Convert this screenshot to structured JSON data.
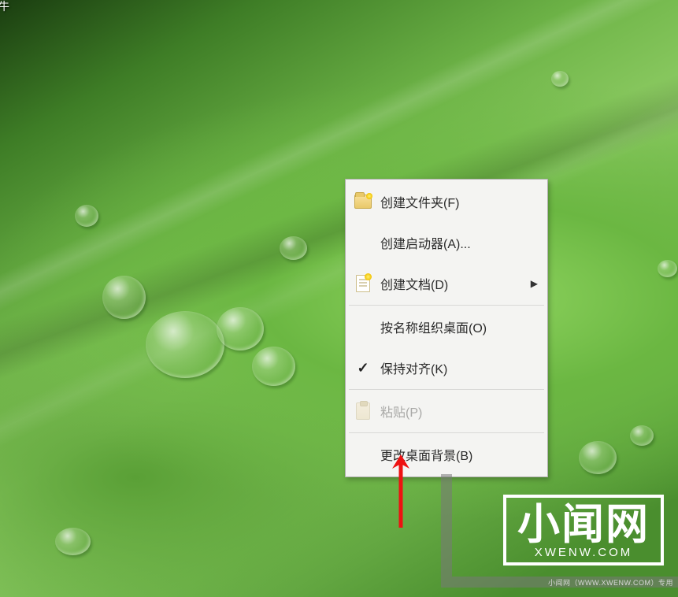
{
  "desktop": {
    "partial_icon_label": "牛"
  },
  "context_menu": {
    "items": [
      {
        "id": "create-folder",
        "label": "创建文件夹(F)",
        "icon": "folder-new-icon",
        "has_submenu": false
      },
      {
        "id": "create-launcher",
        "label": "创建启动器(A)...",
        "icon": null,
        "has_submenu": false
      },
      {
        "id": "create-document",
        "label": "创建文档(D)",
        "icon": "document-new-icon",
        "has_submenu": true
      },
      {
        "sep": true
      },
      {
        "id": "organize-by-name",
        "label": "按名称组织桌面(O)",
        "icon": null,
        "has_submenu": false
      },
      {
        "id": "keep-aligned",
        "label": "保持对齐(K)",
        "icon": "checkmark-icon",
        "checked": true,
        "has_submenu": false
      },
      {
        "sep": true
      },
      {
        "id": "paste",
        "label": "粘贴(P)",
        "icon": "paste-icon",
        "disabled": true,
        "has_submenu": false
      },
      {
        "sep": true
      },
      {
        "id": "change-background",
        "label": "更改桌面背景(B)",
        "icon": null,
        "has_submenu": false
      }
    ]
  },
  "annotation": {
    "arrow_target": "change-background"
  },
  "watermark": {
    "title_cn": "小闻网",
    "title_en": "XWENW.COM",
    "strip_text": "小闻网（WWW.XWENW.COM）专用"
  }
}
